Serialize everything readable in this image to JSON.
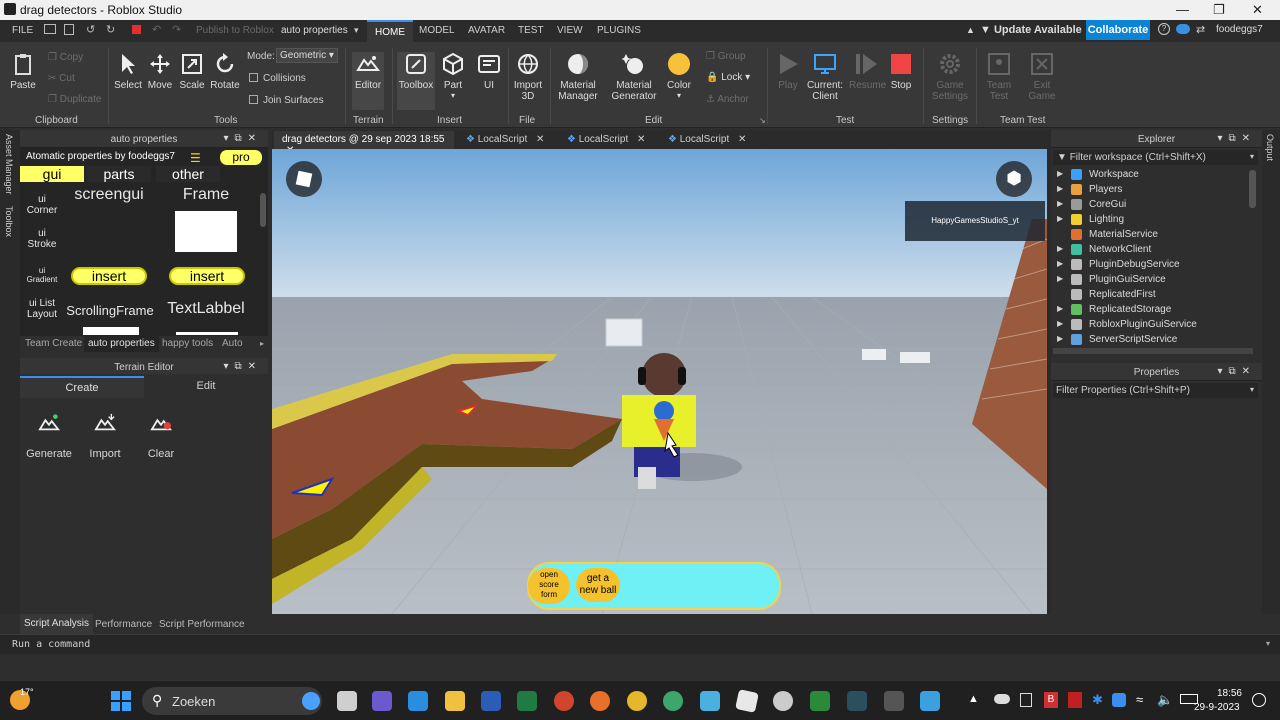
{
  "window": {
    "title": "drag detectors - Roblox Studio"
  },
  "menubar": {
    "file": "FILE",
    "publish": "Publish to Roblox",
    "context": "auto properties",
    "tabs": [
      "HOME",
      "MODEL",
      "AVATAR",
      "TEST",
      "VIEW",
      "PLUGINS"
    ],
    "update": "Update Available",
    "collaborate": "Collaborate",
    "user": "foodeggs7"
  },
  "ribbon": {
    "clipboard": {
      "paste": "Paste",
      "copy": "Copy",
      "cut": "Cut",
      "duplicate": "Duplicate",
      "group": "Clipboard"
    },
    "tools": {
      "select": "Select",
      "move": "Move",
      "scale": "Scale",
      "rotate": "Rotate",
      "mode_label": "Mode:",
      "mode_value": "Geometric",
      "collisions": "Collisions",
      "join_surfaces": "Join Surfaces",
      "group": "Tools"
    },
    "terrain": {
      "editor": "Editor",
      "group": "Terrain"
    },
    "insert": {
      "toolbox": "Toolbox",
      "part": "Part",
      "ui": "UI",
      "group": "Insert"
    },
    "file": {
      "import3d_1": "Import",
      "import3d_2": "3D",
      "group": "File"
    },
    "edit": {
      "material_manager_1": "Material",
      "material_manager_2": "Manager",
      "material_generator_1": "Material",
      "material_generator_2": "Generator",
      "color": "Color",
      "group_btn": "Group",
      "lock": "Lock",
      "anchor": "Anchor",
      "group": "Edit"
    },
    "test": {
      "play": "Play",
      "current_1": "Current:",
      "current_2": "Client",
      "resume": "Resume",
      "stop": "Stop",
      "group": "Test"
    },
    "settings": {
      "game_settings_1": "Game",
      "game_settings_2": "Settings",
      "group": "Settings"
    },
    "team_test": {
      "team_test_1": "Team",
      "team_test_2": "Test",
      "exit_game_1": "Exit",
      "exit_game_2": "Game",
      "group": "Team Test"
    }
  },
  "left_panel": {
    "title": "auto properties",
    "header": "Atomatic properties by foodeggs7",
    "pro": "pro",
    "tabs": [
      "gui",
      "parts",
      "other"
    ],
    "items": {
      "ui_corner_1": "ui",
      "ui_corner_2": "Corner",
      "ui_stroke_1": "ui",
      "ui_stroke_2": "Stroke",
      "ui_gradient_1": "ui",
      "ui_gradient_2": "Gradient",
      "ui_list_1": "ui List",
      "ui_list_2": "Layout",
      "screengui": "screengui",
      "frame": "Frame",
      "insert": "insert",
      "scrollingframe": "ScrollingFrame",
      "textlabel": "TextLabbel"
    },
    "bottom_tabs": [
      "Team Create",
      "auto properties",
      "happy tools",
      "Auto"
    ]
  },
  "side_tabs": {
    "asset_manager": "Asset Manager",
    "toolbox": "Toolbox",
    "output": "Output"
  },
  "terrain_editor": {
    "title": "Terrain Editor",
    "tabs": [
      "Create",
      "Edit"
    ],
    "tools": [
      "Generate",
      "Import",
      "Clear"
    ]
  },
  "viewport_tabs": [
    "drag detectors @ 29 sep 2023 18:55",
    "LocalScript",
    "LocalScript",
    "LocalScript"
  ],
  "viewport": {
    "player_tag": "HappyGamesStudioS_yt",
    "gui_button_open": [
      "open",
      "score",
      "form"
    ],
    "gui_button_ball": [
      "get a",
      "new ball"
    ]
  },
  "explorer": {
    "title": "Explorer",
    "filter": "Filter workspace (Ctrl+Shift+X)",
    "items": [
      {
        "name": "Workspace",
        "color": "#3aa0ff"
      },
      {
        "name": "Players",
        "color": "#e8a040"
      },
      {
        "name": "CoreGui",
        "color": "#9a9a9a"
      },
      {
        "name": "Lighting",
        "color": "#f0d030"
      },
      {
        "name": "MaterialService",
        "color": "#e07030"
      },
      {
        "name": "NetworkClient",
        "color": "#40c0a0"
      },
      {
        "name": "PluginDebugService",
        "color": "#bbbbbb"
      },
      {
        "name": "PluginGuiService",
        "color": "#bbbbbb"
      },
      {
        "name": "ReplicatedFirst",
        "color": "#bbbbbb"
      },
      {
        "name": "ReplicatedStorage",
        "color": "#60c060"
      },
      {
        "name": "RobloxPluginGuiService",
        "color": "#bbbbbb"
      },
      {
        "name": "ServerScriptService",
        "color": "#60a0e0"
      }
    ]
  },
  "properties": {
    "title": "Properties",
    "filter": "Filter Properties (Ctrl+Shift+P)"
  },
  "bottom": {
    "tabs": [
      "Script Analysis",
      "Performance",
      "Script Performance"
    ],
    "command": "Run a command"
  },
  "taskbar": {
    "weather": "17°",
    "search": "Zoeken",
    "time": "18:56",
    "date": "29-9-2023"
  }
}
